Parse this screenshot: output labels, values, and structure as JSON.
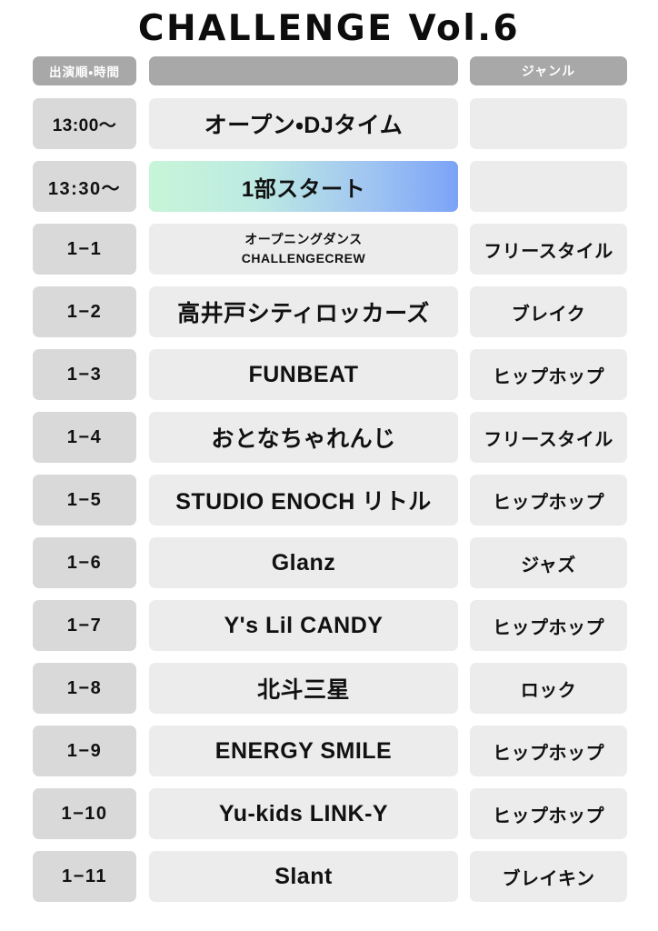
{
  "page": {
    "title": "CHALLENGE Vol.6",
    "accent_gradient_from": "#c7f5d8",
    "accent_gradient_to": "#7ba3f6",
    "header_bg": "#a8a8a8",
    "order_cell_bg": "#d9d9d9",
    "cell_bg": "#ececec",
    "text_color": "#111111"
  },
  "table": {
    "headers": {
      "order": "出演順・時間",
      "name": "",
      "genre": "ジャンル"
    },
    "rows": [
      {
        "order": "13:00〜",
        "name": "オープン・DJタイム",
        "name2": "",
        "genre": "",
        "style": "time"
      },
      {
        "order": "13:30〜",
        "name": "1部スタート",
        "name2": "",
        "genre": "",
        "style": "gradient"
      },
      {
        "order": "1−1",
        "name": "オープニングダンス",
        "name2": "CHALLENGECREW",
        "genre": "フリースタイル",
        "style": "two-line"
      },
      {
        "order": "1−2",
        "name": "高井戸シティロッカーズ",
        "name2": "",
        "genre": "ブレイク",
        "style": "normal"
      },
      {
        "order": "1−3",
        "name": "FUNBEAT",
        "name2": "",
        "genre": "ヒップホップ",
        "style": "normal"
      },
      {
        "order": "1−4",
        "name": "おとなちゃれんじ",
        "name2": "",
        "genre": "フリースタイル",
        "style": "normal"
      },
      {
        "order": "1−5",
        "name": "STUDIO ENOCH リトル",
        "name2": "",
        "genre": "ヒップホップ",
        "style": "normal"
      },
      {
        "order": "1−6",
        "name": "Glanz",
        "name2": "",
        "genre": "ジャズ",
        "style": "normal"
      },
      {
        "order": "1−7",
        "name": "Y's Lil CANDY",
        "name2": "",
        "genre": "ヒップホップ",
        "style": "normal"
      },
      {
        "order": "1−8",
        "name": "北斗三星",
        "name2": "",
        "genre": "ロック",
        "style": "normal"
      },
      {
        "order": "1−9",
        "name": "ENERGY SMILE",
        "name2": "",
        "genre": "ヒップホップ",
        "style": "normal"
      },
      {
        "order": "1−10",
        "name": "Yu-kids LINK-Y",
        "name2": "",
        "genre": "ヒップホップ",
        "style": "normal"
      },
      {
        "order": "1−11",
        "name": "Slant",
        "name2": "",
        "genre": "ブレイキン",
        "style": "normal"
      }
    ]
  }
}
